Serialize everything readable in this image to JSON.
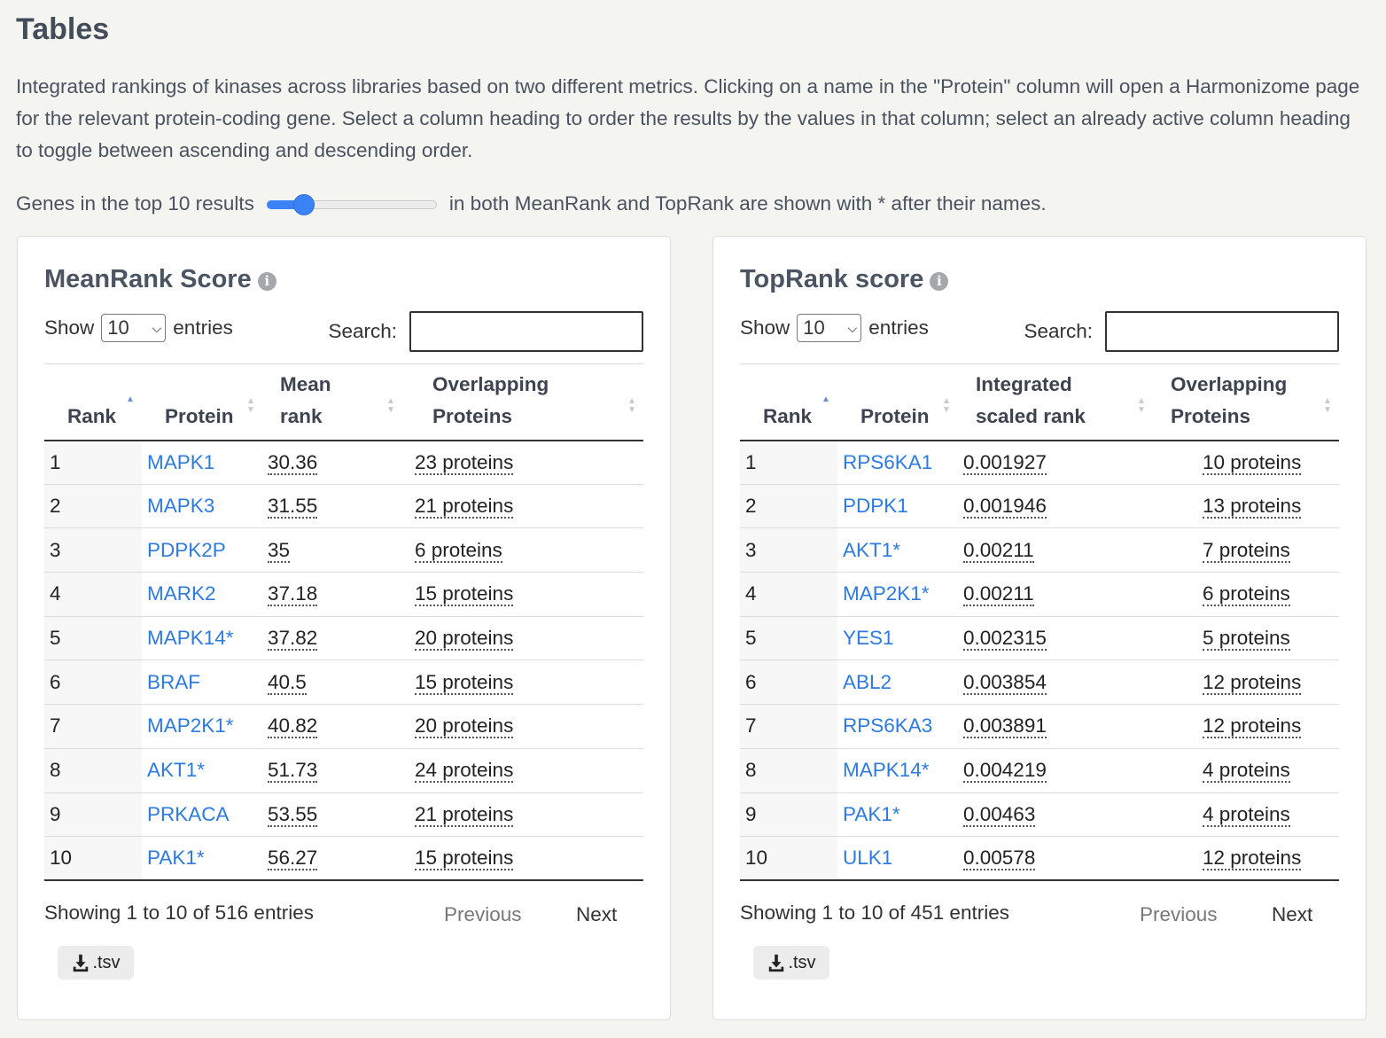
{
  "page": {
    "title": "Tables",
    "intro": "Integrated rankings of kinases across libraries based on two different metrics. Clicking on a name in the \"Protein\" column will open a Harmonizome page for the relevant protein-coding gene. Select a column heading to order the results by the values in that column; select an already active column heading to toggle between ascending and descending order.",
    "slider_prefix": "Genes in the top 10 results",
    "slider_suffix": "in both MeanRank and TopRank are shown with * after their names.",
    "slider_value_fraction": 0.22,
    "accent_color": "#3b82f6",
    "link_color": "#2d7be0"
  },
  "common": {
    "show_label": "Show",
    "entries_label": "entries",
    "page_size": "10",
    "search_label": "Search:",
    "search_value": "",
    "prev_label": "Previous",
    "next_label": "Next",
    "tsv_label": ".tsv",
    "tsv_icon": "download-icon",
    "info_icon": "info-icon"
  },
  "meanrank": {
    "title": "MeanRank Score",
    "headers": [
      "Rank",
      "Protein",
      "Mean rank",
      "Overlapping Proteins"
    ],
    "rows": [
      {
        "rank": "1",
        "protein": "MAPK1",
        "value": "30.36",
        "overlap": "23 proteins"
      },
      {
        "rank": "2",
        "protein": "MAPK3",
        "value": "31.55",
        "overlap": "21 proteins"
      },
      {
        "rank": "3",
        "protein": "PDPK2P",
        "value": "35",
        "overlap": "6 proteins"
      },
      {
        "rank": "4",
        "protein": "MARK2",
        "value": "37.18",
        "overlap": "15 proteins"
      },
      {
        "rank": "5",
        "protein": "MAPK14*",
        "value": "37.82",
        "overlap": "20 proteins"
      },
      {
        "rank": "6",
        "protein": "BRAF",
        "value": "40.5",
        "overlap": "15 proteins"
      },
      {
        "rank": "7",
        "protein": "MAP2K1*",
        "value": "40.82",
        "overlap": "20 proteins"
      },
      {
        "rank": "8",
        "protein": "AKT1*",
        "value": "51.73",
        "overlap": "24 proteins"
      },
      {
        "rank": "9",
        "protein": "PRKACA",
        "value": "53.55",
        "overlap": "21 proteins"
      },
      {
        "rank": "10",
        "protein": "PAK1*",
        "value": "56.27",
        "overlap": "15 proteins"
      }
    ],
    "info": "Showing 1 to 10 of 516 entries"
  },
  "toprank": {
    "title": "TopRank score",
    "headers": [
      "Rank",
      "Protein",
      "Integrated scaled rank",
      "Overlapping Proteins"
    ],
    "rows": [
      {
        "rank": "1",
        "protein": "RPS6KA1",
        "value": "0.001927",
        "overlap": "10 proteins"
      },
      {
        "rank": "2",
        "protein": "PDPK1",
        "value": "0.001946",
        "overlap": "13 proteins"
      },
      {
        "rank": "3",
        "protein": "AKT1*",
        "value": "0.00211",
        "overlap": "7 proteins"
      },
      {
        "rank": "4",
        "protein": "MAP2K1*",
        "value": "0.00211",
        "overlap": "6 proteins"
      },
      {
        "rank": "5",
        "protein": "YES1",
        "value": "0.002315",
        "overlap": "5 proteins"
      },
      {
        "rank": "6",
        "protein": "ABL2",
        "value": "0.003854",
        "overlap": "12 proteins"
      },
      {
        "rank": "7",
        "protein": "RPS6KA3",
        "value": "0.003891",
        "overlap": "12 proteins"
      },
      {
        "rank": "8",
        "protein": "MAPK14*",
        "value": "0.004219",
        "overlap": "4 proteins"
      },
      {
        "rank": "9",
        "protein": "PAK1*",
        "value": "0.00463",
        "overlap": "4 proteins"
      },
      {
        "rank": "10",
        "protein": "ULK1",
        "value": "0.00578",
        "overlap": "12 proteins"
      }
    ],
    "info": "Showing 1 to 10 of 451 entries"
  }
}
